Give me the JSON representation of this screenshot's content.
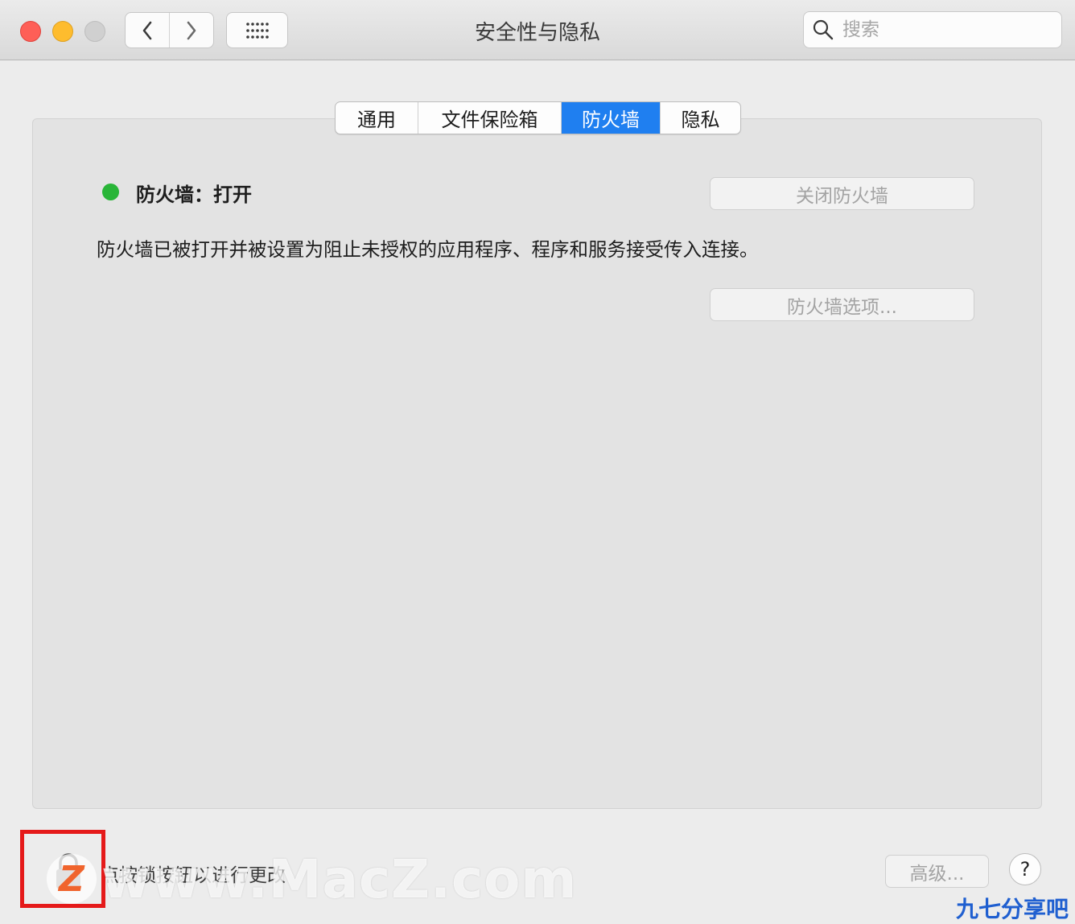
{
  "window": {
    "title": "安全性与隐私",
    "search_placeholder": "搜索"
  },
  "tabs": [
    {
      "label": "通用",
      "active": false
    },
    {
      "label": "文件保险箱",
      "active": false
    },
    {
      "label": "防火墙",
      "active": true
    },
    {
      "label": "隐私",
      "active": false
    }
  ],
  "firewall": {
    "status_label": "防火墙：打开",
    "status_color": "#29b538",
    "description": "防火墙已被打开并被设置为阻止未授权的应用程序、程序和服务接受传入连接。",
    "turn_off_button": "关闭防火墙",
    "options_button": "防火墙选项..."
  },
  "footer": {
    "lock_text": "点按锁按钮以进行更改",
    "advanced_button": "高级...",
    "help_button": "?"
  },
  "watermark": {
    "site_text": "www.MacZ.com",
    "logo_letter": "Z",
    "corner_text": "九七分享吧"
  },
  "colors": {
    "accent": "#1f7ff0",
    "highlight_box": "#e51a1a"
  }
}
